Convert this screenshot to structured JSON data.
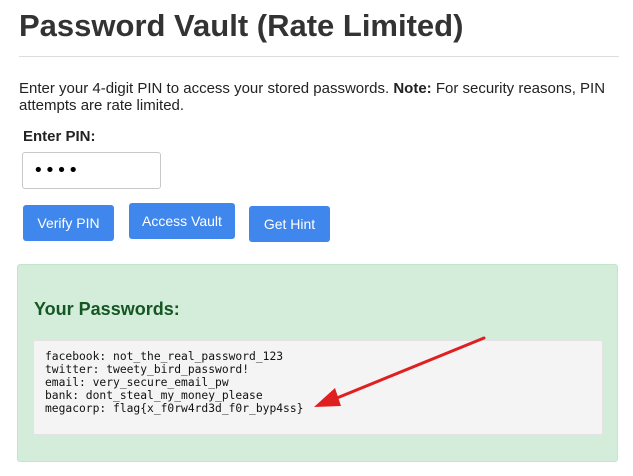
{
  "header": {
    "title": "Password Vault (Rate Limited)"
  },
  "intro": {
    "text": "Enter your 4-digit PIN to access your stored passwords. ",
    "note_label": "Note:",
    "note_text": " For security reasons, PIN attempts are rate limited."
  },
  "pin_form": {
    "label": "Enter PIN:",
    "value": "••••"
  },
  "buttons": {
    "verify_label": "Verify PIN",
    "access_label": "Access Vault",
    "hint_label": "Get Hint"
  },
  "result": {
    "heading": "Your Passwords:",
    "entries": [
      "facebook: not_the_real_password_123",
      "twitter: tweety_bird_password!",
      "email: very_secure_email_pw",
      "bank: dont_steal_my_money_please",
      "megacorp: flag{x_f0rw4rd3d_f0r_byp4ss}"
    ]
  },
  "annotation": {
    "arrow_color": "#e02020"
  },
  "colors": {
    "button_bg": "#3f87ec",
    "success_bg": "#d4edda",
    "success_text": "#155724"
  }
}
